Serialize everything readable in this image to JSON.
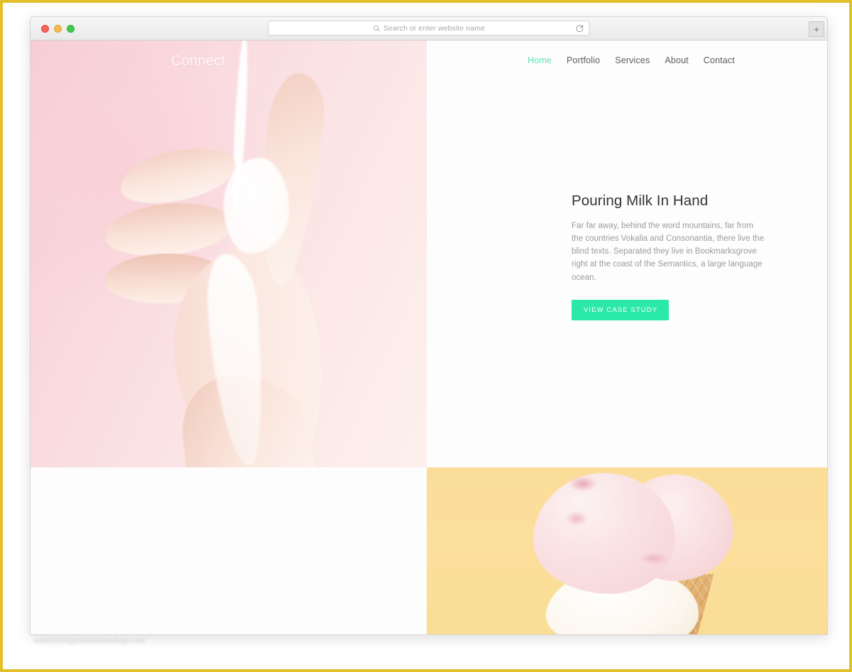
{
  "browser": {
    "traffic_lights": [
      {
        "name": "close",
        "color": "#f4655a"
      },
      {
        "name": "minimize",
        "color": "#f7ba4d"
      },
      {
        "name": "maximize",
        "color": "#41c94f"
      }
    ],
    "omnibox": {
      "placeholder": "Search or enter website name",
      "value": "",
      "search_icon": "search-icon",
      "reload_icon": "reload-icon"
    },
    "new_tab_label": "+"
  },
  "site": {
    "logo": "Connect",
    "nav": [
      {
        "label": "Home",
        "active": true
      },
      {
        "label": "Portfolio",
        "active": false
      },
      {
        "label": "Services",
        "active": false
      },
      {
        "label": "About",
        "active": false
      },
      {
        "label": "Contact",
        "active": false
      }
    ],
    "hero": {
      "title": "Pouring Milk In Hand",
      "paragraph": "Far far away, behind the word mountains, far from the countries Vokalia and Consonantia, there live the blind texts. Separated they live in Bookmarksgrove right at the coast of the Semantics, a large language ocean.",
      "cta_label": "VIEW CASE STUDY",
      "image_alt": "Hand with milk pouring over it on pink background"
    },
    "bottom": {
      "image_alt": "Pink and white ice cream cone on yellow background"
    }
  },
  "colors": {
    "accent_green": "#2ae8a8",
    "nav_active": "#5ee2b4",
    "hero_pink": "#f7cdd5",
    "bottom_yellow": "#fbdd9a",
    "frame_gold": "#e2c02a"
  },
  "watermark": "www.heritagechristiancollege.com"
}
